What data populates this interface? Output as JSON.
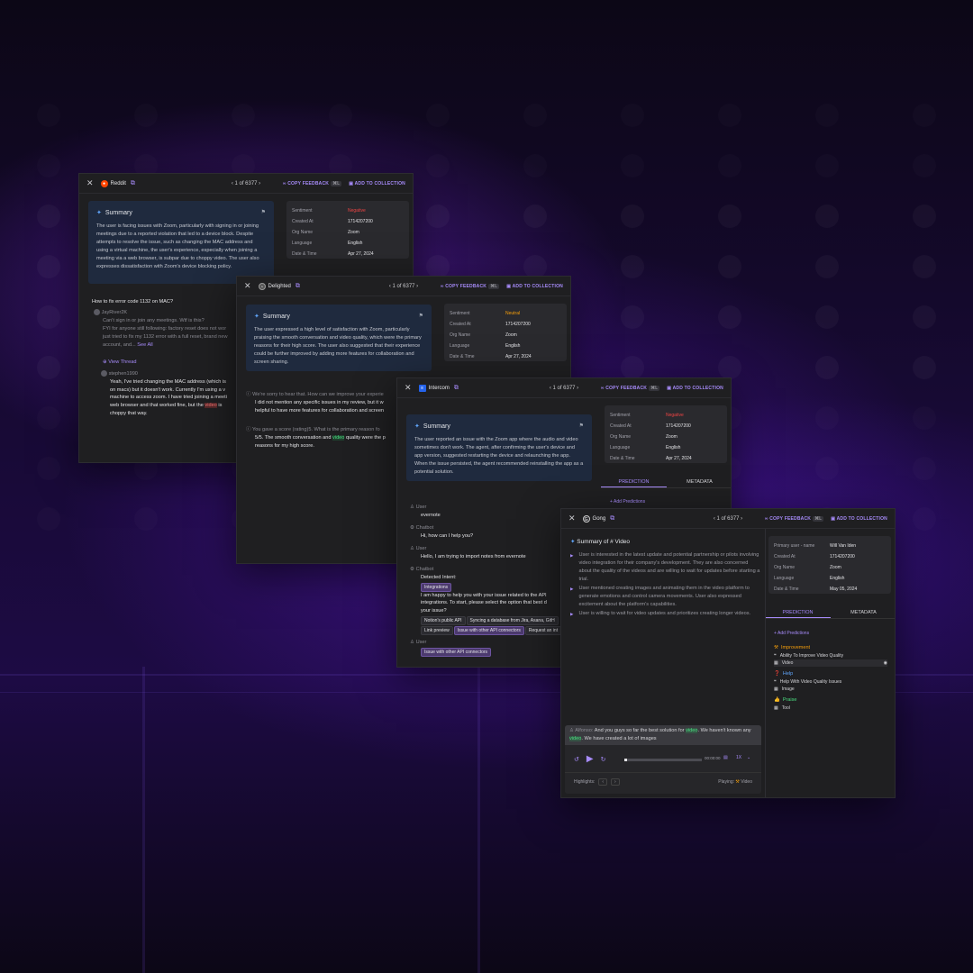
{
  "windows": [
    {
      "source": "Reddit",
      "pager": "1 of 6377",
      "copy": "COPY FEEDBACK",
      "kbd": "⌘L",
      "add": "ADD TO COLLECTION",
      "summary_title": "Summary",
      "summary": "The user is facing issues with Zoom, particularly with signing in or joining meetings due to a reported violation that led to a device block. Despite attempts to resolve the issue, such as changing the MAC address and using a virtual machine, the user's experience, especially when joining a meeting via a web browser, is subpar due to choppy video. The user also expresses dissatisfaction with Zoom's device blocking policy.",
      "meta": [
        [
          "Sentiment",
          "Negative"
        ],
        [
          "Created At",
          "1714207200"
        ],
        [
          "Org Name",
          "Zoom"
        ],
        [
          "Language",
          "English"
        ],
        [
          "Date & Time",
          "Apr 27, 2024"
        ]
      ],
      "question": "How to fix error code 1132 on MAC?",
      "poster": "JayRiver2K",
      "post1": "Can't sign in or join any meetings. Wtf is this?",
      "post2": "FYI for anyone still following: factory reset does not wor",
      "post3": "just tried to fix my 1132 error with a full reset, brand new",
      "post4": "account, and...",
      "see_all": "See All",
      "view_thread": "View Thread",
      "replier": "stephen1990",
      "reply1": "Yeah, I've tried changing the MAC address (which is",
      "reply2": "on macs) but it doesn't work. Currently I'm using a v",
      "reply3": "machine to access zoom. I have tried joining a meeti",
      "reply4a": "web browser and that worked fine, but the ",
      "reply4b": "video",
      "reply4c": " is",
      "reply5": "choppy that way."
    },
    {
      "source": "Delighted",
      "pager": "1 of 6377",
      "copy": "COPY FEEDBACK",
      "kbd": "⌘L",
      "add": "ADD TO COLLECTION",
      "summary_title": "Summary",
      "summary": "The user expressed a high level of satisfaction with Zoom, particularly praising the smooth conversation and video quality, which were the primary reasons for their high score. The user also suggested that their experience could be further improved by adding more features for collaboration and screen sharing.",
      "meta": [
        [
          "Sentiment",
          "Neutral"
        ],
        [
          "Created At",
          "1714207200"
        ],
        [
          "Org Name",
          "Zoom"
        ],
        [
          "Language",
          "English"
        ],
        [
          "Date & Time",
          "Apr 27, 2024"
        ]
      ],
      "q1": "We're sorry to hear that. How can we improve your experie",
      "a1a": "I did not mention any specific issues in my review, but it w",
      "a1b": "helpful to have more features for collaboration and screen",
      "q2": "You gave a score (rating)5. What is the primary reason fo",
      "a2a": "5/5. The smooth conversation and ",
      "a2b": "video",
      "a2c": " quality were the p",
      "a2d": "reasons for my high score."
    },
    {
      "source": "Intercom",
      "pager": "1 of 6377",
      "copy": "COPY FEEDBACK",
      "kbd": "⌘L",
      "add": "ADD TO COLLECTION",
      "summary_title": "Summary",
      "summary": "The user reported an issue with the Zoom app where the audio and video sometimes don't work. The agent, after confirming the user's device and app version, suggested restarting the device and relaunching the app. When the issue persisted, the agent recommended reinstalling the app as a potential solution.",
      "meta": [
        [
          "Sentiment",
          "Negative"
        ],
        [
          "Created At",
          "1714207200"
        ],
        [
          "Org Name",
          "Zoom"
        ],
        [
          "Language",
          "English"
        ],
        [
          "Date & Time",
          "Apr 27, 2024"
        ]
      ],
      "tab1": "PREDICTION",
      "tab2": "METADATA",
      "add_pred": "Add Predictions",
      "user_label": "User",
      "bot_label": "Chatbot",
      "m1": "evernote",
      "m2": "Hi, how can I help you?",
      "m3": "Hello, I am trying to import notes from evernote",
      "detected": "Detected Intent:",
      "intent": "Integrations",
      "m4a": "I am happy to help you with your issue related to the API",
      "m4b": "integrations. To start, please select the option that best d",
      "m4c": "your issue?",
      "chips": [
        "Notion's public API",
        "Syncing a database from Jira, Asana, GitH",
        "Link preview",
        "Issue with other API connectors",
        "Request an int"
      ],
      "m5": "Issue with other API connectors"
    },
    {
      "source": "Gong",
      "pager": "1 of 6377",
      "copy": "COPY FEEDBACK",
      "kbd": "⌘L",
      "add": "ADD TO COLLECTION",
      "summary_title": "Summary of # Video",
      "bullets": [
        "User is interested in the latest update and potential partnership or pilots involving video integration for their company's development. They are also concerned about the quality of the videos and are willing to wait for updates before starting a trial.",
        "User mentioned creating images and animating them in the video platform to generate emotions and control camera movements. User also expressed excitement about the platform's capabilities.",
        "User is willing to wait for video updates and prioritizes creating longer videos."
      ],
      "meta": [
        [
          "Primary user - name",
          "Will Van Iden"
        ],
        [
          "Created At",
          "1714207200"
        ],
        [
          "Org Name",
          "Zoom"
        ],
        [
          "Language",
          "English"
        ],
        [
          "Date & Time",
          "May 05, 2024"
        ]
      ],
      "tab1": "PREDICTION",
      "tab2": "METADATA",
      "add_pred": "Add Predictions",
      "cat1": "Improvement",
      "c1i1": "Ability To Improve Video Quality",
      "c1i2": "Video",
      "cat2": "Help",
      "c2i1": "Help With Video Quality Issues",
      "c2i2": "Image",
      "cat3": "Praise",
      "c3i1": "Tool",
      "speaker": "Alfonso:",
      "t1": "And you guys so far the best solution for ",
      "t2": "video",
      "t3": ". We haven't known any ",
      "t4": "video",
      "t5": ". We have created a lot of images",
      "time": "00:00:00",
      "speed": "1X",
      "highlights": "Highlights:",
      "playing": "Playing:",
      "playing_val": "Video",
      "playback_progress": 0.04
    }
  ],
  "colors": {
    "accent": "#a78bfa",
    "negative": "#ef4444",
    "neutral": "#f59e0b",
    "summary_bg": "#1f2a3e"
  }
}
